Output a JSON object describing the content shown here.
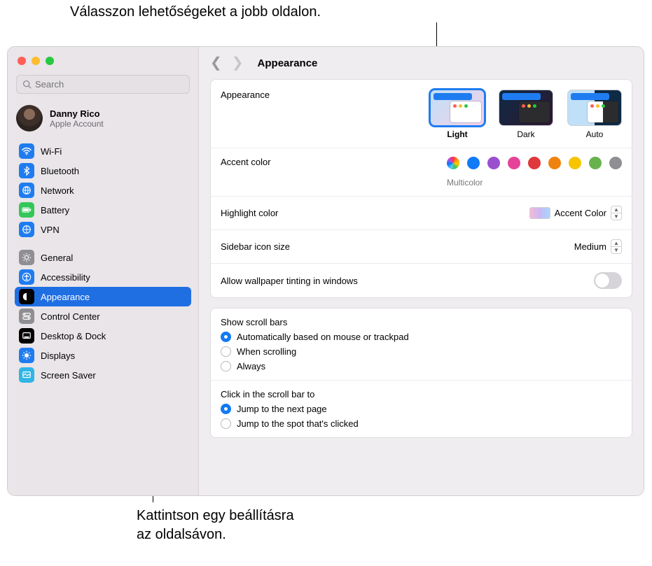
{
  "annotations": {
    "top": "Válasszon lehetőségeket a jobb oldalon.",
    "bottom_line1": "Kattintson egy beállításra",
    "bottom_line2": "az oldalsávon."
  },
  "search": {
    "placeholder": "Search"
  },
  "account": {
    "name": "Danny Rico",
    "sub": "Apple Account"
  },
  "sidebar": {
    "wifi": "Wi-Fi",
    "bluetooth": "Bluetooth",
    "network": "Network",
    "battery": "Battery",
    "vpn": "VPN",
    "general": "General",
    "accessibility": "Accessibility",
    "appearance": "Appearance",
    "control_center": "Control Center",
    "desktop_dock": "Desktop & Dock",
    "displays": "Displays",
    "screen_saver": "Screen Saver"
  },
  "title": "Appearance",
  "rows": {
    "appearance": "Appearance",
    "accent": "Accent color",
    "accent_sub": "Multicolor",
    "highlight": "Highlight color",
    "highlight_value": "Accent Color",
    "sidebar_icon": "Sidebar icon size",
    "sidebar_icon_value": "Medium",
    "wallpaper": "Allow wallpaper tinting in windows",
    "scrollbars_title": "Show scroll bars",
    "scroll_opt1": "Automatically based on mouse or trackpad",
    "scroll_opt2": "When scrolling",
    "scroll_opt3": "Always",
    "click_title": "Click in the scroll bar to",
    "click_opt1": "Jump to the next page",
    "click_opt2": "Jump to the spot that's clicked"
  },
  "themes": {
    "light": "Light",
    "dark": "Dark",
    "auto": "Auto"
  }
}
